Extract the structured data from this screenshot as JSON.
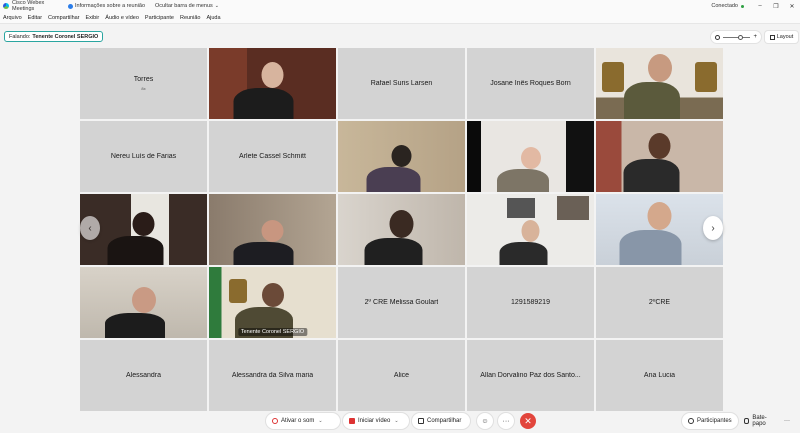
{
  "titlebar": {
    "app_title": "Cisco Webex Meetings",
    "meeting_info": "Informações sobre a reunião",
    "hide_menu": "Ocultar barra de menus",
    "status": "Conectado",
    "minimize": "–",
    "restore": "❐",
    "close": "✕"
  },
  "menubar": {
    "items": [
      "Arquivo",
      "Editar",
      "Compartilhar",
      "Exibir",
      "Áudio e vídeo",
      "Participante",
      "Reunião",
      "Ajuda"
    ]
  },
  "speaking": {
    "label": "Falando:",
    "name": "Tenente Coronel SERGIO"
  },
  "layout_button": "Layout",
  "zoom": {
    "plus": "+",
    "level": 0.55
  },
  "tiles": [
    {
      "name": "Torres",
      "sub": "8x",
      "video": false
    },
    {
      "name": "",
      "video": true
    },
    {
      "name": "Rafael Suris Larsen",
      "video": false
    },
    {
      "name": "Josane Inês Roques Born",
      "video": false
    },
    {
      "name": "",
      "video": true
    },
    {
      "name": "Nereu Luís de Farias",
      "video": false
    },
    {
      "name": "Arlete Cassel Schmitt",
      "video": false
    },
    {
      "name": "",
      "video": true
    },
    {
      "name": "",
      "video": true
    },
    {
      "name": "",
      "video": true
    },
    {
      "name": "",
      "video": true
    },
    {
      "name": "",
      "video": true
    },
    {
      "name": "",
      "video": true
    },
    {
      "name": "",
      "video": true
    },
    {
      "name": "",
      "video": true
    },
    {
      "name": "",
      "video": true
    },
    {
      "name": "",
      "video": true,
      "tag": "Tenente Coronel SERGIO",
      "active": true
    },
    {
      "name": "2º CRE Melissa Goulart",
      "video": false
    },
    {
      "name": "1291589219",
      "video": false
    },
    {
      "name": "2ºCRE",
      "video": false
    },
    {
      "name": "Alessandra",
      "video": false
    },
    {
      "name": "Alessandra da Silva maria",
      "video": false
    },
    {
      "name": "Alice",
      "video": false
    },
    {
      "name": "Allan Dorvalino Paz dos Santo...",
      "video": false
    },
    {
      "name": "Ana Lucia",
      "video": false
    }
  ],
  "nav": {
    "prev": "‹",
    "next": "›"
  },
  "controls": {
    "mute": "Ativar o som",
    "video": "Iniciar vídeo",
    "share": "Compartilhar",
    "reactions": "☺",
    "more": "···",
    "end": "✕",
    "participants": "Participantes",
    "chat": "Bate-papo",
    "overflow": "···",
    "dropdown": "⌄"
  }
}
